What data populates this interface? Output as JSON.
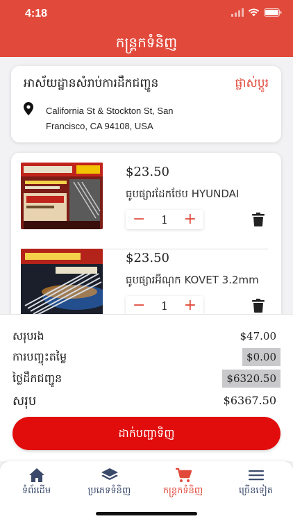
{
  "status_bar": {
    "time": "4:18"
  },
  "header": {
    "title": "កន្ត្រកទំនិញ"
  },
  "address": {
    "title": "អាស័យដ្ឋានសំរាប់ការដឹកជញ្ជូន",
    "change_label": "ផ្លាស់ប្តូរ",
    "line1": "California St & Stockton St, San",
    "line2": "Francisco, CA 94108, USA"
  },
  "cart": {
    "items": [
      {
        "price": "$23.50",
        "name": "ធូបផ្សារដែកថែប HYUNDAI",
        "quantity": "1",
        "minus": "−",
        "plus": "+"
      },
      {
        "price": "$23.50",
        "name": "ធូបផ្សារអ៊ីណុក KOVET 3.2mm",
        "quantity": "1",
        "minus": "−",
        "plus": "+"
      }
    ]
  },
  "summary": {
    "subtotal_label": "សរុបរង",
    "subtotal_value": "$47.00",
    "discount_label": "ការបញ្ចុះតម្លៃ",
    "discount_value": "$0.00",
    "delivery_label": "ថ្លៃដឹកជញ្ជូន",
    "delivery_value": "$6320.50",
    "total_label": "សរុប",
    "total_value": "$6367.50"
  },
  "checkout": {
    "label": "ដាក់បញ្ជាទិញ"
  },
  "tabbar": {
    "tabs": [
      {
        "label": "ទំព័រដើម",
        "icon": "home-icon"
      },
      {
        "label": "ប្រភេទទំនិញ",
        "icon": "layers-icon"
      },
      {
        "label": "កន្ត្រកទំនិញ",
        "icon": "cart-icon",
        "active": true
      },
      {
        "label": "ច្រើនទៀត",
        "icon": "menu-icon"
      }
    ]
  },
  "colors": {
    "accent": "#e14a3b",
    "button": "#e10d0d",
    "tab_text": "#3b4a6b"
  }
}
